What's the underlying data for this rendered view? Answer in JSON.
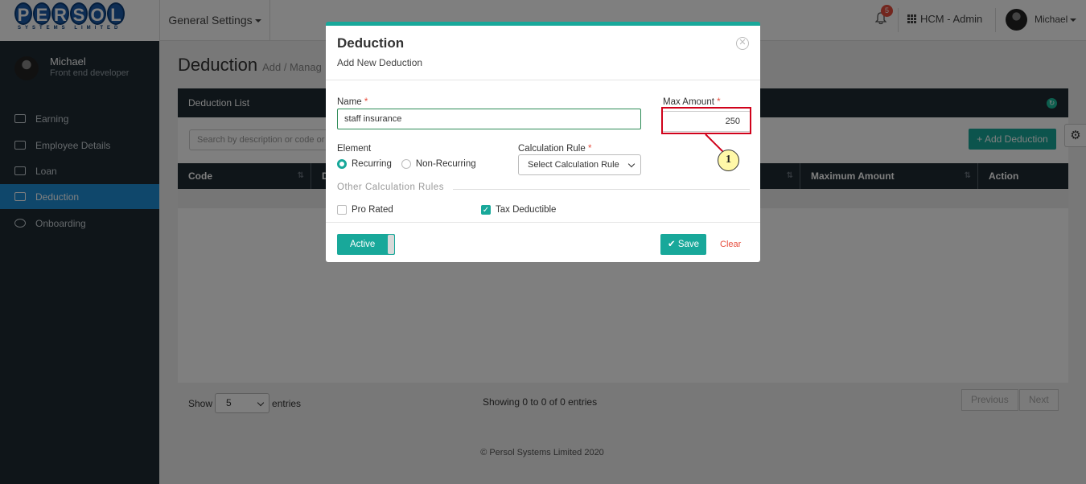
{
  "topbar": {
    "logo_text": "PERSOL",
    "logo_sub": "SYSTEMS LIMITED",
    "menu_label": "General Settings",
    "notification_count": "5",
    "app_label": "HCM - Admin",
    "user_name": "Michael"
  },
  "sidebar": {
    "user_name": "Michael",
    "user_role": "Front end developer",
    "items": [
      {
        "label": "Earning",
        "icon": "money-icon"
      },
      {
        "label": "Employee Details",
        "icon": "id-card-icon"
      },
      {
        "label": "Loan",
        "icon": "cash-icon"
      },
      {
        "label": "Deduction",
        "icon": "deduction-icon",
        "active": true
      },
      {
        "label": "Onboarding",
        "icon": "cloud-upload-icon"
      }
    ]
  },
  "page": {
    "title": "Deduction",
    "subtitle": "Add / Manag",
    "panel_title": "Deduction List",
    "search_placeholder": "Search by description or code or",
    "add_button": "Add Deduction",
    "columns": [
      "Code",
      "D",
      "Maximum Amount",
      "Action"
    ],
    "show_label": "Show",
    "show_value": "5",
    "entries_label": "entries",
    "showing_text": "Showing 0 to 0 of 0 entries",
    "prev_label": "Previous",
    "next_label": "Next",
    "copyright": "© Persol Systems Limited 2020"
  },
  "modal": {
    "title": "Deduction",
    "subtitle": "Add New Deduction",
    "name_label": "Name",
    "name_value": "staff insurance",
    "max_label": "Max Amount",
    "max_value": "250",
    "element_label": "Element",
    "radio_recurring": "Recurring",
    "radio_nonrecurring": "Non-Recurring",
    "calc_label": "Calculation Rule",
    "calc_value": "Select Calculation Rule",
    "other_rules": "Other Calculation Rules",
    "pro_rated": "Pro Rated",
    "tax_deductible": "Tax Deductible",
    "active_label": "Active",
    "save_label": "Save",
    "clear_label": "Clear",
    "required_mark": "*"
  },
  "annotation": {
    "callout_number": "1",
    "highlight_color": "#d0021b"
  },
  "colors": {
    "accent": "#18a89a",
    "sidebar_bg": "#1e2a33",
    "active_item": "#1f8fd6",
    "danger": "#e74c3c"
  }
}
